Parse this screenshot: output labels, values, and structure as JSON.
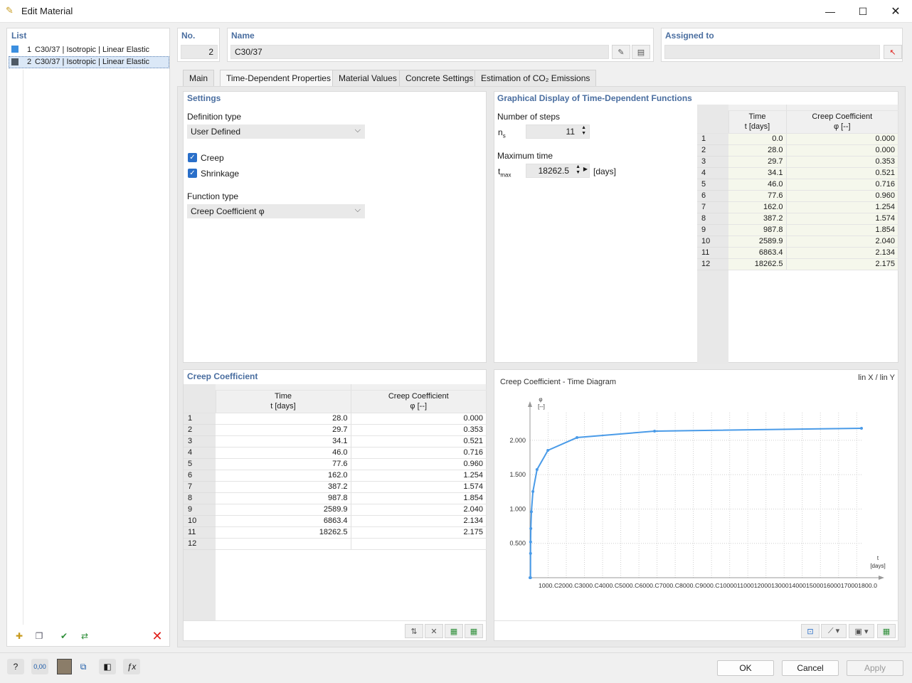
{
  "window": {
    "title": "Edit Material"
  },
  "list": {
    "title": "List",
    "items": [
      {
        "no": "1",
        "label": "C30/37 | Isotropic | Linear Elastic",
        "color": "#3b8fe0"
      },
      {
        "no": "2",
        "label": "C30/37 | Isotropic | Linear Elastic",
        "color": "#4e5a66"
      }
    ]
  },
  "header": {
    "no_label": "No.",
    "no_value": "2",
    "name_label": "Name",
    "name_value": "C30/37",
    "assigned_label": "Assigned to",
    "assigned_value": ""
  },
  "tabs": [
    "Main",
    "Time-Dependent Properties",
    "Material Values",
    "Concrete Settings",
    "Estimation of CO₂ Emissions"
  ],
  "settings": {
    "title": "Settings",
    "definition_type_label": "Definition type",
    "definition_type_value": "User Defined",
    "creep_label": "Creep",
    "shrinkage_label": "Shrinkage",
    "function_type_label": "Function type",
    "function_type_value": "Creep Coefficient φ"
  },
  "graphical": {
    "title": "Graphical Display of Time-Dependent Functions",
    "steps_label": "Number of steps",
    "ns_sym": "n",
    "ns_sub": "s",
    "ns_value": "11",
    "max_time_label": "Maximum time",
    "tmax_sym": "t",
    "tmax_sub": "max",
    "tmax_value": "18262.5",
    "tmax_unit": "[days]"
  },
  "graph_table": {
    "col1_line1": "Time",
    "col1_line2": "t [days]",
    "col2_line1": "Creep Coefficient",
    "col2_line2": "φ [--]",
    "rows": [
      [
        "1",
        "0.0",
        "0.000"
      ],
      [
        "2",
        "28.0",
        "0.000"
      ],
      [
        "3",
        "29.7",
        "0.353"
      ],
      [
        "4",
        "34.1",
        "0.521"
      ],
      [
        "5",
        "46.0",
        "0.716"
      ],
      [
        "6",
        "77.6",
        "0.960"
      ],
      [
        "7",
        "162.0",
        "1.254"
      ],
      [
        "8",
        "387.2",
        "1.574"
      ],
      [
        "9",
        "987.8",
        "1.854"
      ],
      [
        "10",
        "2589.9",
        "2.040"
      ],
      [
        "11",
        "6863.4",
        "2.134"
      ],
      [
        "12",
        "18262.5",
        "2.175"
      ]
    ]
  },
  "creep_table": {
    "title": "Creep Coefficient",
    "col1_line1": "Time",
    "col1_line2": "t [days]",
    "col2_line1": "Creep Coefficient",
    "col2_line2": "φ [--]",
    "rows": [
      [
        "1",
        "28.0",
        "0.000"
      ],
      [
        "2",
        "29.7",
        "0.353"
      ],
      [
        "3",
        "34.1",
        "0.521"
      ],
      [
        "4",
        "46.0",
        "0.716"
      ],
      [
        "5",
        "77.6",
        "0.960"
      ],
      [
        "6",
        "162.0",
        "1.254"
      ],
      [
        "7",
        "387.2",
        "1.574"
      ],
      [
        "8",
        "987.8",
        "1.854"
      ],
      [
        "9",
        "2589.9",
        "2.040"
      ],
      [
        "10",
        "6863.4",
        "2.134"
      ],
      [
        "11",
        "18262.5",
        "2.175"
      ],
      [
        "12",
        "",
        ""
      ]
    ]
  },
  "chart_data": {
    "type": "line",
    "title": "Creep Coefficient - Time Diagram",
    "scale_label": "lin X / lin Y",
    "ylabel": "φ",
    "yunit": "[--]",
    "xlabel": "t",
    "xunit": "[days]",
    "yticks": [
      "0.500",
      "1.000",
      "1.500",
      "2.000"
    ],
    "ytick_values": [
      0.5,
      1.0,
      1.5,
      2.0
    ],
    "xtick_text": "1000.C2000.C3000.C4000.C5000.C6000.C7000.C8000.C9000.C10000110001200013000140001500016000170001800.0",
    "xlim": [
      0,
      18262.5
    ],
    "ylim": [
      0,
      2.175
    ],
    "grid": true,
    "series": [
      {
        "x": [
          0.0,
          28.0,
          29.7,
          34.1,
          46.0,
          77.6,
          162.0,
          387.2,
          987.8,
          2589.9,
          6863.4,
          18262.5
        ],
        "y": [
          0.0,
          0.0,
          0.353,
          0.521,
          0.716,
          0.96,
          1.254,
          1.574,
          1.854,
          2.04,
          2.134,
          2.175
        ],
        "color": "#4a9be8"
      }
    ]
  },
  "buttons": {
    "ok": "OK",
    "cancel": "Cancel",
    "apply": "Apply"
  },
  "footer": {
    "units_label": "0,00"
  },
  "colors": {
    "section_title": "#4a6ea0",
    "delete_red": "#e0201b",
    "accent_blue": "#2a6fc9"
  }
}
